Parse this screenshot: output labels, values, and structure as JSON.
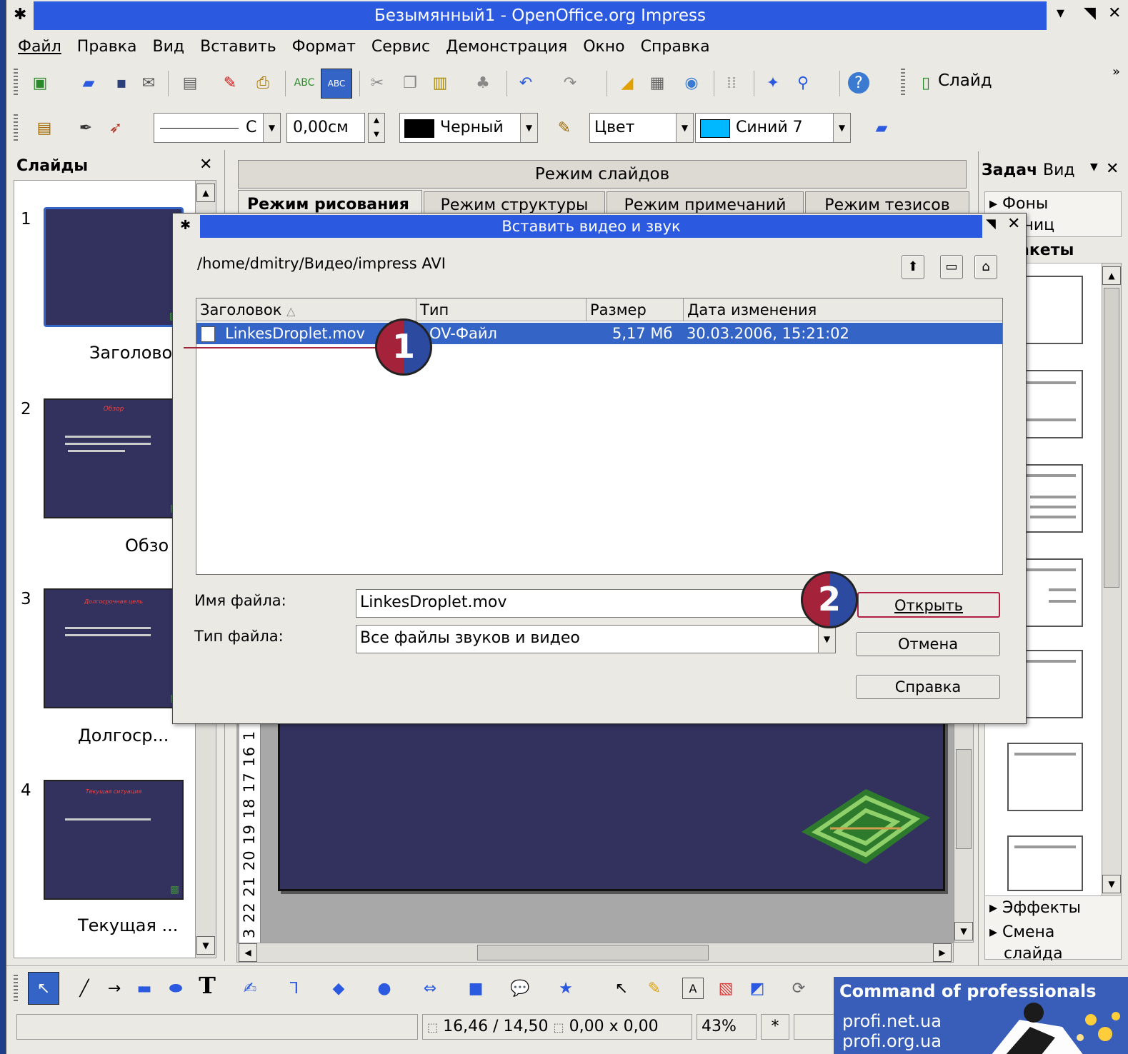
{
  "window": {
    "title": "Безымянный1 - OpenOffice.org Impress",
    "pin_glyph": "✱",
    "min_glyph": "▾",
    "max_glyph": "◥",
    "close_glyph": "✕"
  },
  "menu": [
    "Файл",
    "Правка",
    "Вид",
    "Вставить",
    "Формат",
    "Сервис",
    "Демонстрация",
    "Окно",
    "Справка"
  ],
  "toolbar1": {
    "slide_label": "Слайд",
    "more_glyph": "»"
  },
  "toolbar2": {
    "line_style_value": "С",
    "line_width_value": "0,00см",
    "line_color_value": "Черный",
    "line_color_swatch": "#000000",
    "area_style_value": "Цвет",
    "area_color_value": "Синий 7",
    "area_color_swatch": "#00b8ff"
  },
  "slides_panel": {
    "title": "Слайды",
    "slides": [
      {
        "number": "1",
        "caption": "Заголово",
        "title": ""
      },
      {
        "number": "2",
        "caption": "Обзо",
        "title": "Обзор"
      },
      {
        "number": "3",
        "caption": "Долгоср...",
        "title": "Долгосрочная цель"
      },
      {
        "number": "4",
        "caption": "Текущая ...",
        "title": "Текущая ситуация"
      }
    ]
  },
  "view_tabs": {
    "header": "Режим слайдов",
    "tabs": [
      "Режим рисования",
      "Режим структуры",
      "Режим примечаний",
      "Режим тезисов"
    ]
  },
  "ruler": {
    "numbers": "3 22 21 20 19 18 17 16 1"
  },
  "tasks_panel": {
    "title": "Задач",
    "view_menu": "Вид",
    "sections": [
      "Фоны",
      "раниц",
      "акеты"
    ],
    "bottom_sections": [
      "Эффекты",
      "Смена",
      "слайда"
    ]
  },
  "dialog": {
    "title": "Вставить видео и звук",
    "path": "/home/dmitry/Видео/impress AVI",
    "columns": [
      "Заголовок",
      "Тип",
      "Размер",
      "Дата изменения"
    ],
    "sort_glyph": "△",
    "files": [
      {
        "name": "LinkesDroplet.mov",
        "type": "OV-Файл",
        "size": "5,17 Мб",
        "date": "30.03.2006, 15:21:02"
      }
    ],
    "filename_label": "Имя файла:",
    "filename_value": "LinkesDroplet.mov",
    "filetype_label": "Тип файла:",
    "filetype_value": "Все файлы звуков и видео",
    "open_button": "Открыть",
    "cancel_button": "Отмена",
    "help_button": "Справка"
  },
  "annotations": {
    "badge1": "1",
    "badge2": "2"
  },
  "status_bar": {
    "position": "16,46 / 14,50",
    "size": "0,00 x 0,00",
    "zoom": "43%",
    "modified": "*"
  },
  "watermark": {
    "line1": "Command of professionals",
    "line2": "profi.net.ua",
    "line3": "profi.org.ua"
  },
  "colors": {
    "title_blue": "#2b5ae0",
    "slide_bg": "#33325f",
    "selection": "#3465c6",
    "badge_red": "#a4223a"
  }
}
